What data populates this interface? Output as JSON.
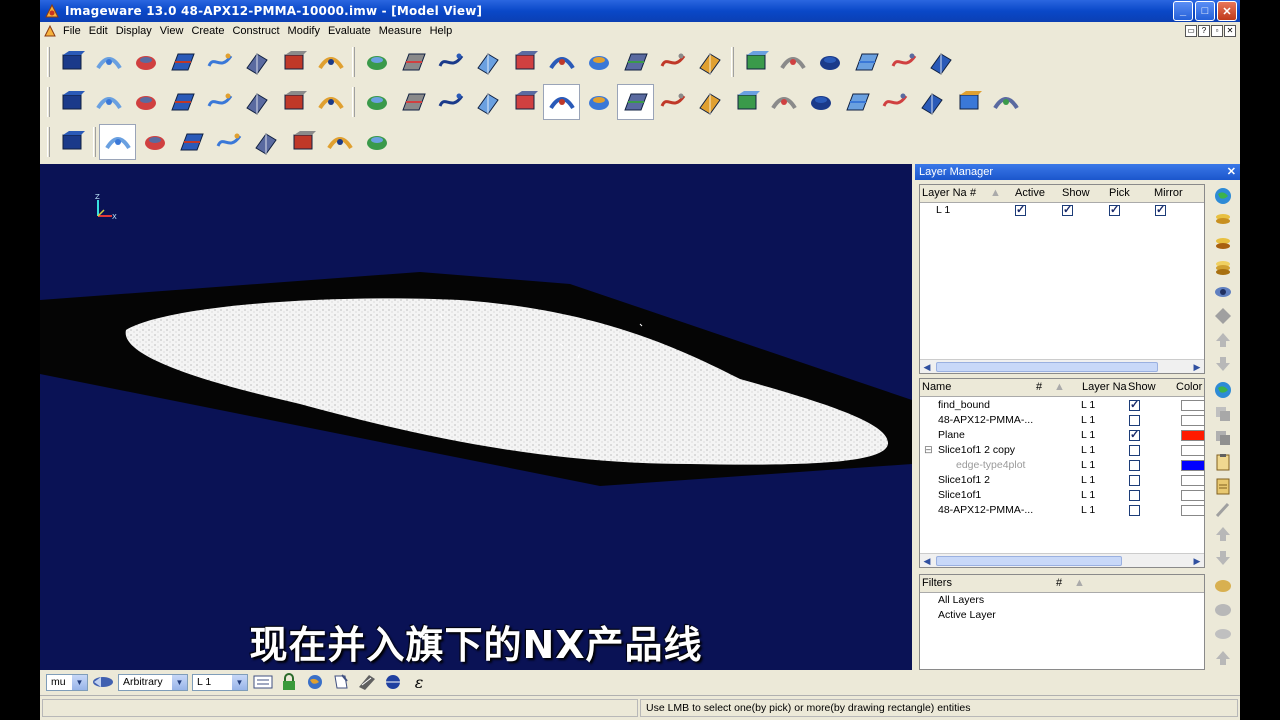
{
  "window": {
    "title": "Imageware 13.0    48-APX12-PMMA-10000.imw - [Model View]",
    "controls": [
      "_",
      "□",
      "✕"
    ]
  },
  "menu": {
    "items": [
      "File",
      "Edit",
      "Display",
      "View",
      "Create",
      "Construct",
      "Modify",
      "Evaluate",
      "Measure",
      "Help"
    ],
    "mdi": [
      "▭",
      "?",
      "▫",
      "✕"
    ]
  },
  "toolbar_icons": {
    "row1": [
      "open-file",
      "curve-tools",
      "magnifier-points",
      "surface-box",
      "cube-view",
      "layer-stack",
      "cloud-dome",
      "shell-surface",
      "blue-plane",
      "blue-plane-2",
      "tube-surface",
      "color-ring",
      "curved-sheet",
      "curved-sheet-2",
      "stacked-sheets",
      "folded-sheet",
      "pencil-sheet",
      "pyramid",
      "wire-box",
      "wire-box-2",
      "node-network",
      "blue-pod",
      "arrow-plane",
      "axis-points"
    ],
    "row2": [
      "green-surface",
      "extrude",
      "plane-tilt",
      "red-axes",
      "plane-flat",
      "slab",
      "light-bulb",
      "sphere-cut",
      "eye-view",
      "camera",
      "sheets-fan",
      "sheets-flat",
      "color-gradient",
      "cloud-outline",
      "spline-curve",
      "blue-patch",
      "arc-fan",
      "grid-matrix",
      "red-bolt",
      "spiral-curve",
      "point-line",
      "circle-target",
      "zigzag-curve",
      "red-sheet",
      "red-cross",
      "red-circle-x"
    ],
    "row3": [
      "color-palette",
      "globe",
      "cloud-arrows",
      "cloud-sparkle",
      "cube-teal",
      "wave-plane",
      "wave-curve",
      "blue-flat",
      "yellow-lines"
    ]
  },
  "viewport": {
    "axis_label_z": "Z",
    "axis_label_x": "X",
    "subtitle": "现在并入旗下的NX产品线"
  },
  "layer_manager": {
    "title": "Layer Manager",
    "close": "✕",
    "layer_columns": [
      "Layer Na",
      "#",
      "Active",
      "Show",
      "Pick",
      "Mirror"
    ],
    "layers": [
      {
        "name": "L 1",
        "active": true,
        "show": true,
        "pick": true,
        "mirror": true
      }
    ],
    "object_columns": [
      "Name",
      "#",
      "Layer Na",
      "Show",
      "Color"
    ],
    "objects": [
      {
        "name": "find_bound",
        "layer": "L 1",
        "show": true,
        "color": "#ffffff",
        "indent": 0,
        "dim": false
      },
      {
        "name": "48-APX12-PMMA-...",
        "layer": "L 1",
        "show": false,
        "color": "#ffffff",
        "indent": 0,
        "dim": false
      },
      {
        "name": "Plane",
        "layer": "L 1",
        "show": true,
        "color": "#ff1a00",
        "indent": 0,
        "dim": false
      },
      {
        "name": "Slice1of1 2 copy",
        "layer": "L 1",
        "show": false,
        "color": "#ffffff",
        "indent": 0,
        "dim": false,
        "expander": "⊟"
      },
      {
        "name": "edge-type4plot",
        "layer": "L 1",
        "show": false,
        "color": "#0000ff",
        "indent": 1,
        "dim": true
      },
      {
        "name": "Slice1of1 2",
        "layer": "L 1",
        "show": false,
        "color": "#ffffff",
        "indent": 0,
        "dim": false
      },
      {
        "name": "Slice1of1",
        "layer": "L 1",
        "show": false,
        "color": "#ffffff",
        "indent": 0,
        "dim": false
      },
      {
        "name": "48-APX12-PMMA-...",
        "layer": "L 1",
        "show": false,
        "color": "#ffffff",
        "indent": 0,
        "dim": false
      }
    ],
    "filters_title": "Filters",
    "filters_hash": "#",
    "filters": [
      "All Layers",
      "Active Layer"
    ]
  },
  "bottom_toolbar": {
    "unit": "mu",
    "view_mode": "Arbitrary",
    "layer": "L 1",
    "epsilon": "ε"
  },
  "status": {
    "message": "Use LMB to select one(by pick) or more(by drawing rectangle) entities"
  }
}
